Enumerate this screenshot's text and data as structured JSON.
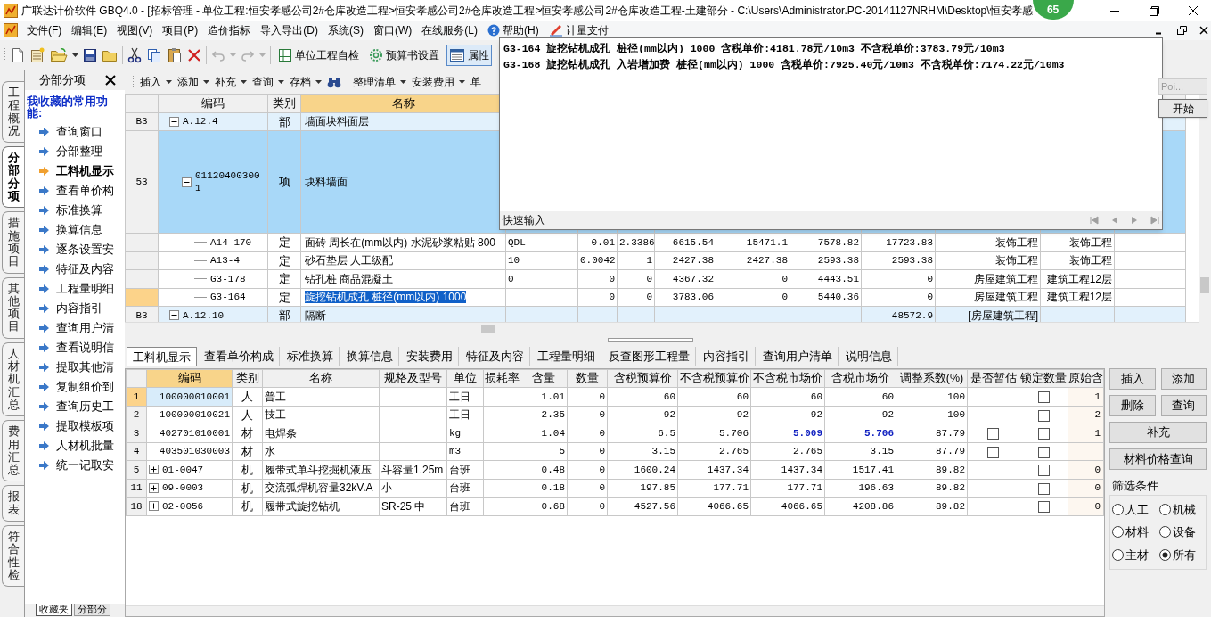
{
  "window": {
    "title": "广联达计价软件 GBQ4.0 - [招标管理 - 单位工程:恒安孝感公司2#仓库改造工程>恒安孝感公司2#仓库改造工程>恒安孝感公司2#仓库改造工程-土建部分 - C:\\Users\\Administrator.PC-20141127NRHM\\Desktop\\恒安孝感",
    "badge": "65"
  },
  "menu": [
    {
      "label": "文件(F)",
      "kind": "plain"
    },
    {
      "label": "编辑(E)",
      "kind": "plain"
    },
    {
      "label": "视图(V)",
      "kind": "plain"
    },
    {
      "label": "项目(P)",
      "kind": "plain"
    },
    {
      "label": "造价指标",
      "kind": "plain"
    },
    {
      "label": "导入导出(D)",
      "kind": "plain"
    },
    {
      "label": "系统(S)",
      "kind": "plain"
    },
    {
      "label": "窗口(W)",
      "kind": "plain"
    },
    {
      "label": "在线服务(L)",
      "kind": "plain"
    },
    {
      "label": "帮助(H)",
      "kind": "help"
    },
    {
      "label": "计量支付",
      "kind": "tool"
    }
  ],
  "toolbar": [
    {
      "label": "单位工程自检",
      "kind": "check",
      "pressed": false
    },
    {
      "label": "预算书设置",
      "kind": "settings",
      "pressed": false
    },
    {
      "label": "属性",
      "kind": "window",
      "pressed": true
    }
  ],
  "left_tabs": [
    {
      "label": "工程概况",
      "selected": false
    },
    {
      "label": "分部分项",
      "selected": true
    },
    {
      "label": "措施项目",
      "selected": false
    },
    {
      "label": "其他项目",
      "selected": false
    },
    {
      "label": "人材机汇总",
      "selected": false
    },
    {
      "label": "费用汇总",
      "selected": false
    },
    {
      "label": "报表",
      "selected": false
    },
    {
      "label": "符合性检",
      "selected": false
    }
  ],
  "side_panel": {
    "title": "分部分项",
    "favorites_title": "我收藏的常用功能:",
    "items": [
      {
        "label": "查询窗口",
        "selected": false
      },
      {
        "label": "分部整理",
        "selected": false
      },
      {
        "label": "工料机显示",
        "selected": true
      },
      {
        "label": "查看单价构",
        "selected": false
      },
      {
        "label": "标准换算",
        "selected": false
      },
      {
        "label": "换算信息",
        "selected": false
      },
      {
        "label": "逐条设置安",
        "selected": false
      },
      {
        "label": "特征及内容",
        "selected": false
      },
      {
        "label": "工程量明细",
        "selected": false
      },
      {
        "label": "内容指引",
        "selected": false
      },
      {
        "label": "查询用户清",
        "selected": false
      },
      {
        "label": "查看说明信",
        "selected": false
      },
      {
        "label": "提取其他清",
        "selected": false
      },
      {
        "label": "复制组价到",
        "selected": false
      },
      {
        "label": "查询历史工",
        "selected": false
      },
      {
        "label": "提取模板项",
        "selected": false
      },
      {
        "label": "人材机批量",
        "selected": false
      },
      {
        "label": "统一记取安",
        "selected": false
      }
    ],
    "bottom_tabs": [
      {
        "label": "收藏夹",
        "selected": true
      },
      {
        "label": "分部分",
        "selected": false
      }
    ]
  },
  "edit_toolbar": [
    {
      "label": "插入",
      "kind": "dropdown"
    },
    {
      "label": "添加",
      "kind": "dropdown"
    },
    {
      "label": "补充",
      "kind": "dropdown"
    },
    {
      "label": "查询",
      "kind": "dropdown"
    },
    {
      "label": "存档",
      "kind": "dropdown"
    },
    {
      "kind": "find"
    },
    {
      "label": "整理清单",
      "kind": "dropdown"
    },
    {
      "label": "安装费用",
      "kind": "dropdown"
    },
    {
      "label": "单",
      "kind": "plain"
    }
  ],
  "upper_table": {
    "columns": [
      "编码",
      "类别",
      "名称"
    ],
    "rows": [
      {
        "row_label": "B3",
        "code": "A.12.4",
        "type": "部",
        "name": "墙面块料面层",
        "kind": "section",
        "expanded": true,
        "selected": false,
        "focused": false,
        "children": [
          {
            "row_label": "53",
            "code": "011204003001",
            "type": "项",
            "name": "块料墙面",
            "kind": "item",
            "expanded": true,
            "selected": true,
            "focused": false,
            "children": [
              {
                "code": "A14-170",
                "type": "定",
                "name": "面砖 周长在(mm以内) 水泥砂浆粘贴 800",
                "kind": "quota",
                "selected": false,
                "focused": false,
                "cells": [
                  "QDL",
                  "0.01",
                  "2.3386",
                  "6615.54",
                  "15471.1",
                  "7578.82",
                  "17723.83",
                  "装饰工程",
                  "装饰工程"
                ]
              },
              {
                "code": "A13-4",
                "type": "定",
                "name": "砂石垫层 人工级配",
                "kind": "quota",
                "selected": false,
                "focused": false,
                "cells": [
                  "10",
                  "0.0042",
                  "1",
                  "2427.38",
                  "2427.38",
                  "2593.38",
                  "2593.38",
                  "装饰工程",
                  "装饰工程"
                ]
              },
              {
                "code": "G3-178",
                "type": "定",
                "name": "钻孔桩 商品混凝土",
                "kind": "quota",
                "selected": false,
                "focused": false,
                "cells": [
                  "0",
                  "0",
                  "0",
                  "4367.32",
                  "0",
                  "4443.51",
                  "0",
                  "房屋建筑工程",
                  "建筑工程12层"
                ]
              },
              {
                "code": "G3-164",
                "type": "定",
                "name": "旋挖钻机成孔 桩径(mm以内) 1000",
                "kind": "quota",
                "selected": false,
                "focused": true,
                "cells": [
                  null,
                  "0",
                  "0",
                  "3783.06",
                  "0",
                  "5440.36",
                  "0",
                  "房屋建筑工程",
                  "建筑工程12层"
                ]
              }
            ]
          }
        ]
      },
      {
        "row_label": "B3",
        "code": "A.12.10",
        "type": "部",
        "name": "隔断",
        "kind": "section",
        "expanded": true,
        "selected": false,
        "focused": false,
        "cells": [
          null,
          null,
          null,
          null,
          null,
          null,
          "48572.9",
          "[房屋建筑工程]",
          null
        ]
      }
    ]
  },
  "quick_input": {
    "lines": [
      "G3-164 旋挖钻机成孔 桩径(mm以内) 1000 含税单价:4181.78元/10m3 不含税单价:3783.79元/10m3",
      "G3-168 旋挖钻机成孔 入岩增加费 桩径(mm以内) 1000 含税单价:7925.40元/10m3 不含税单价:7174.22元/10m3"
    ],
    "footer": "快速输入"
  },
  "side_tool": {
    "field": "Poi...",
    "button": "开始"
  },
  "detail_tabs": [
    {
      "label": "工料机显示",
      "selected": true
    },
    {
      "label": "查看单价构成",
      "selected": false
    },
    {
      "label": "标准换算",
      "selected": false
    },
    {
      "label": "换算信息",
      "selected": false
    },
    {
      "label": "安装费用",
      "selected": false
    },
    {
      "label": "特征及内容",
      "selected": false
    },
    {
      "label": "工程量明细",
      "selected": false
    },
    {
      "label": "反查图形工程量",
      "selected": false
    },
    {
      "label": "内容指引",
      "selected": false
    },
    {
      "label": "查询用户清单",
      "selected": false
    },
    {
      "label": "说明信息",
      "selected": false
    }
  ],
  "detail_table": {
    "columns": [
      "编码",
      "类别",
      "名称",
      "规格及型号",
      "单位",
      "损耗率",
      "含量",
      "数量",
      "含税预算价",
      "不含税预算价",
      "不含税市场价",
      "含税市场价",
      "调整系数(%)",
      "是否暂估",
      "锁定数量",
      "原始含"
    ],
    "rows": [
      {
        "index": "1",
        "expandable": false,
        "selected": true,
        "changed": false,
        "cells": [
          "100000010001",
          "人",
          "普工",
          null,
          "工日",
          null,
          "1.01",
          "0",
          "60",
          "60",
          "60",
          "60",
          "100"
        ],
        "provisional": null,
        "locked": false,
        "original": "1"
      },
      {
        "index": "2",
        "expandable": false,
        "selected": false,
        "changed": false,
        "cells": [
          "100000010021",
          "人",
          "技工",
          null,
          "工日",
          null,
          "2.35",
          "0",
          "92",
          "92",
          "92",
          "92",
          "100"
        ],
        "provisional": null,
        "locked": false,
        "original": "2"
      },
      {
        "index": "3",
        "expandable": false,
        "selected": false,
        "changed": true,
        "cells": [
          "402701010001",
          "材",
          "电焊条",
          null,
          "kg",
          null,
          "1.04",
          "0",
          "6.5",
          "5.706",
          "5.009",
          "5.706",
          "87.79"
        ],
        "provisional": false,
        "locked": false,
        "original": "1"
      },
      {
        "index": "4",
        "expandable": false,
        "selected": false,
        "changed": false,
        "cells": [
          "403501030003",
          "材",
          "水",
          null,
          "m3",
          null,
          "5",
          "0",
          "3.15",
          "2.765",
          "2.765",
          "3.15",
          "87.79"
        ],
        "provisional": false,
        "locked": false,
        "original": null
      },
      {
        "index": "5",
        "expandable": true,
        "selected": false,
        "changed": false,
        "cells": [
          "01-0047",
          "机",
          "履带式单斗挖掘机液压",
          "斗容量1.25m",
          "台班",
          null,
          "0.48",
          "0",
          "1600.24",
          "1437.34",
          "1437.34",
          "1517.41",
          "89.82"
        ],
        "provisional": null,
        "locked": false,
        "original": "0"
      },
      {
        "index": "11",
        "expandable": true,
        "selected": false,
        "changed": false,
        "cells": [
          "09-0003",
          "机",
          "交流弧焊机容量32kV.A",
          "小",
          "台班",
          null,
          "0.18",
          "0",
          "197.85",
          "177.71",
          "177.71",
          "196.63",
          "89.82"
        ],
        "provisional": null,
        "locked": false,
        "original": "0"
      },
      {
        "index": "18",
        "expandable": true,
        "selected": false,
        "changed": false,
        "cells": [
          "02-0056",
          "机",
          "履带式旋挖钻机",
          "SR-25 中",
          "台班",
          null,
          "0.68",
          "0",
          "4527.56",
          "4066.65",
          "4066.65",
          "4208.86",
          "89.82"
        ],
        "provisional": null,
        "locked": false,
        "original": "0"
      }
    ]
  },
  "action_buttons": [
    {
      "label": "插入",
      "wide": false
    },
    {
      "label": "添加",
      "wide": false
    },
    {
      "label": "删除",
      "wide": false
    },
    {
      "label": "查询",
      "wide": false
    },
    {
      "label": "补充",
      "wide": true
    },
    {
      "label": "材料价格查询",
      "wide": true
    }
  ],
  "filter": {
    "title": "筛选条件",
    "options": [
      {
        "label": "人工",
        "selected": false
      },
      {
        "label": "机械",
        "selected": false
      },
      {
        "label": "材料",
        "selected": false
      },
      {
        "label": "设备",
        "selected": false
      },
      {
        "label": "主材",
        "selected": false
      },
      {
        "label": "所有",
        "selected": true
      }
    ]
  }
}
